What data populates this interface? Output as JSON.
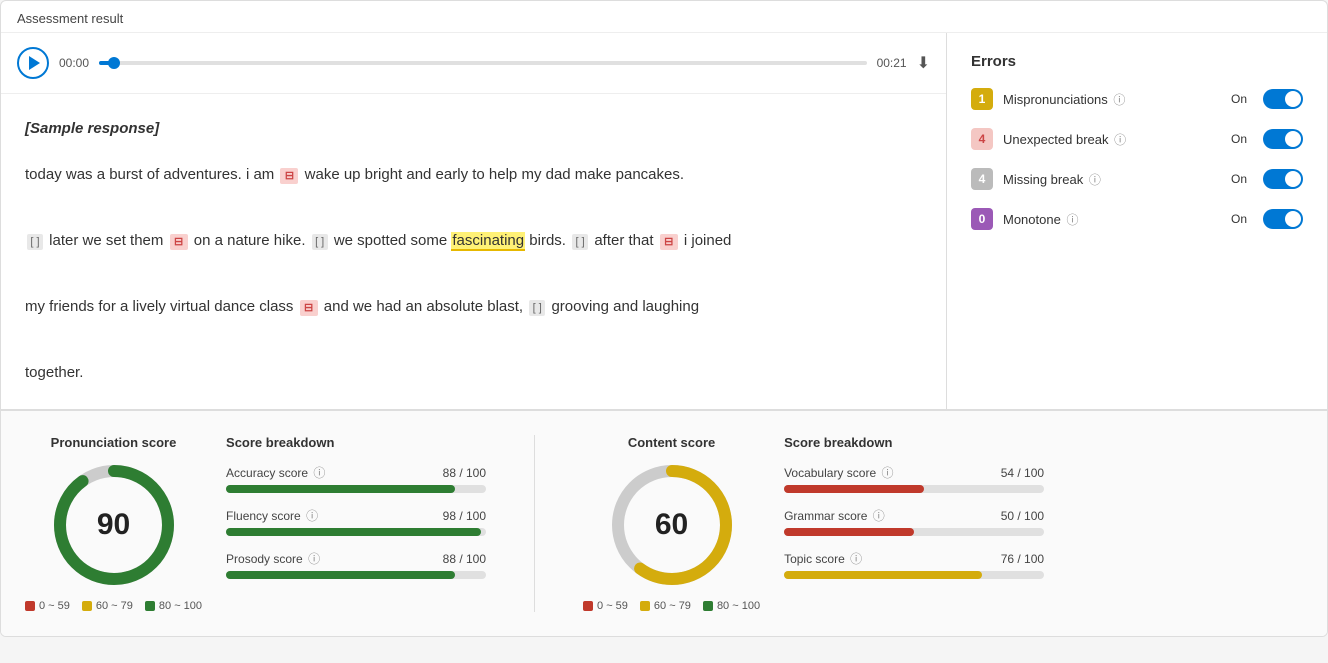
{
  "page": {
    "title": "Assessment result"
  },
  "audio": {
    "time_start": "00:00",
    "time_end": "00:21",
    "progress_percent": 2
  },
  "sample_label": "[Sample response]",
  "text_body": {
    "line1": "today was a burst of adventures. i am",
    "line1_end": "wake up bright and early to help my dad make pancakes.",
    "line2_start": "later we set them",
    "line2_mid1": "on a nature hike.",
    "line2_mid2": "we spotted some",
    "line2_highlighted": "fascinating",
    "line2_mid3": "birds.",
    "line2_after": "after that",
    "line2_end_start": "i joined",
    "line3_start": "my friends for a lively virtual dance class",
    "line3_mid": "and we had an absolute blast,",
    "line3_end": "grooving and laughing",
    "line4": "together."
  },
  "errors": {
    "title": "Errors",
    "items": [
      {
        "badge": "1",
        "badge_class": "badge-yellow",
        "label": "Mispronunciations",
        "toggle_label": "On",
        "toggle_on": true
      },
      {
        "badge": "4",
        "badge_class": "badge-pink",
        "label": "Unexpected break",
        "toggle_label": "On",
        "toggle_on": true
      },
      {
        "badge": "4",
        "badge_class": "badge-gray",
        "label": "Missing break",
        "toggle_label": "On",
        "toggle_on": true
      },
      {
        "badge": "0",
        "badge_class": "badge-purple",
        "label": "Monotone",
        "toggle_label": "On",
        "toggle_on": true
      }
    ]
  },
  "pronunciation_score": {
    "title": "Pronunciation score",
    "value": 90,
    "donut": {
      "radius": 54,
      "stroke_width": 12,
      "green_percent": 90,
      "gray_percent": 10,
      "green_color": "#2e7d32",
      "gray_color": "#ccc"
    },
    "legend": [
      {
        "label": "0 ~ 59",
        "color": "#c0392b"
      },
      {
        "label": "60 ~ 79",
        "color": "#d4ac0d"
      },
      {
        "label": "80 ~ 100",
        "color": "#2e7d32"
      }
    ],
    "breakdown": {
      "title": "Score breakdown",
      "items": [
        {
          "label": "Accuracy score",
          "value": "88 / 100",
          "percent": 88,
          "color": "#2e7d32"
        },
        {
          "label": "Fluency score",
          "value": "98 / 100",
          "percent": 98,
          "color": "#2e7d32"
        },
        {
          "label": "Prosody score",
          "value": "88 / 100",
          "percent": 88,
          "color": "#2e7d32"
        }
      ]
    }
  },
  "content_score": {
    "title": "Content score",
    "value": 60,
    "donut": {
      "radius": 54,
      "stroke_width": 12,
      "yellow_percent": 60,
      "gray_percent": 40,
      "yellow_color": "#d4ac0d",
      "gray_color": "#ccc"
    },
    "legend": [
      {
        "label": "0 ~ 59",
        "color": "#c0392b"
      },
      {
        "label": "60 ~ 79",
        "color": "#d4ac0d"
      },
      {
        "label": "80 ~ 100",
        "color": "#2e7d32"
      }
    ],
    "breakdown": {
      "title": "Score breakdown",
      "items": [
        {
          "label": "Vocabulary score",
          "value": "54 / 100",
          "percent": 54,
          "color": "#c0392b"
        },
        {
          "label": "Grammar score",
          "value": "50 / 100",
          "percent": 50,
          "color": "#c0392b"
        },
        {
          "label": "Topic score",
          "value": "76 / 100",
          "percent": 76,
          "color": "#d4ac0d"
        }
      ]
    }
  }
}
